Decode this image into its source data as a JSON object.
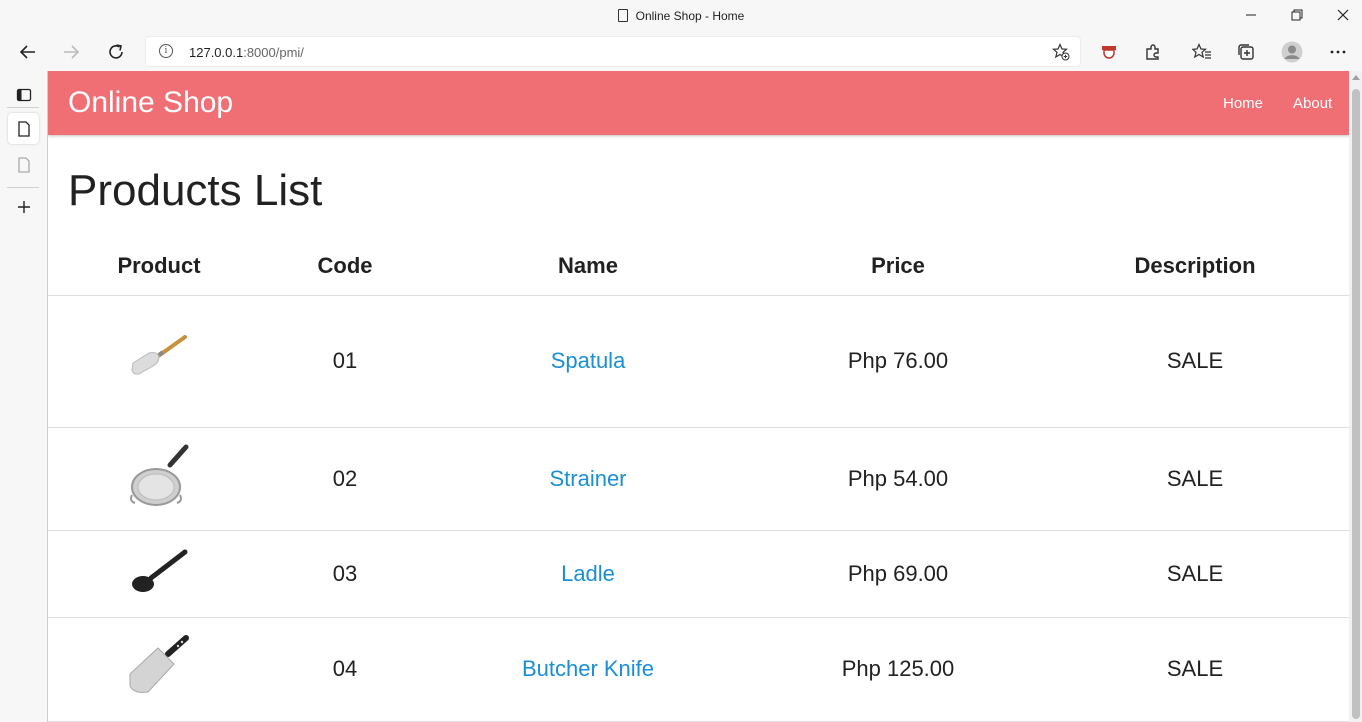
{
  "browser": {
    "window_title": "Online Shop - Home",
    "url_host": "127.0.0.1",
    "url_path": ":8000/pmi/"
  },
  "site": {
    "brand": "Online Shop",
    "nav": [
      {
        "label": "Home"
      },
      {
        "label": "About"
      }
    ],
    "accent_color": "#ef6f75",
    "link_color": "#1a8fd6"
  },
  "page": {
    "heading": "Products List",
    "columns": [
      "Product",
      "Code",
      "Name",
      "Price",
      "Description"
    ],
    "rows": [
      {
        "image": "spatula-image",
        "code": "01",
        "name": "Spatula",
        "price": "Php 76.00",
        "description": "SALE"
      },
      {
        "image": "strainer-image",
        "code": "02",
        "name": "Strainer",
        "price": "Php 54.00",
        "description": "SALE"
      },
      {
        "image": "ladle-image",
        "code": "03",
        "name": "Ladle",
        "price": "Php 69.00",
        "description": "SALE"
      },
      {
        "image": "butcher-knife-image",
        "code": "04",
        "name": "Butcher Knife",
        "price": "Php 125.00",
        "description": "SALE"
      }
    ]
  }
}
